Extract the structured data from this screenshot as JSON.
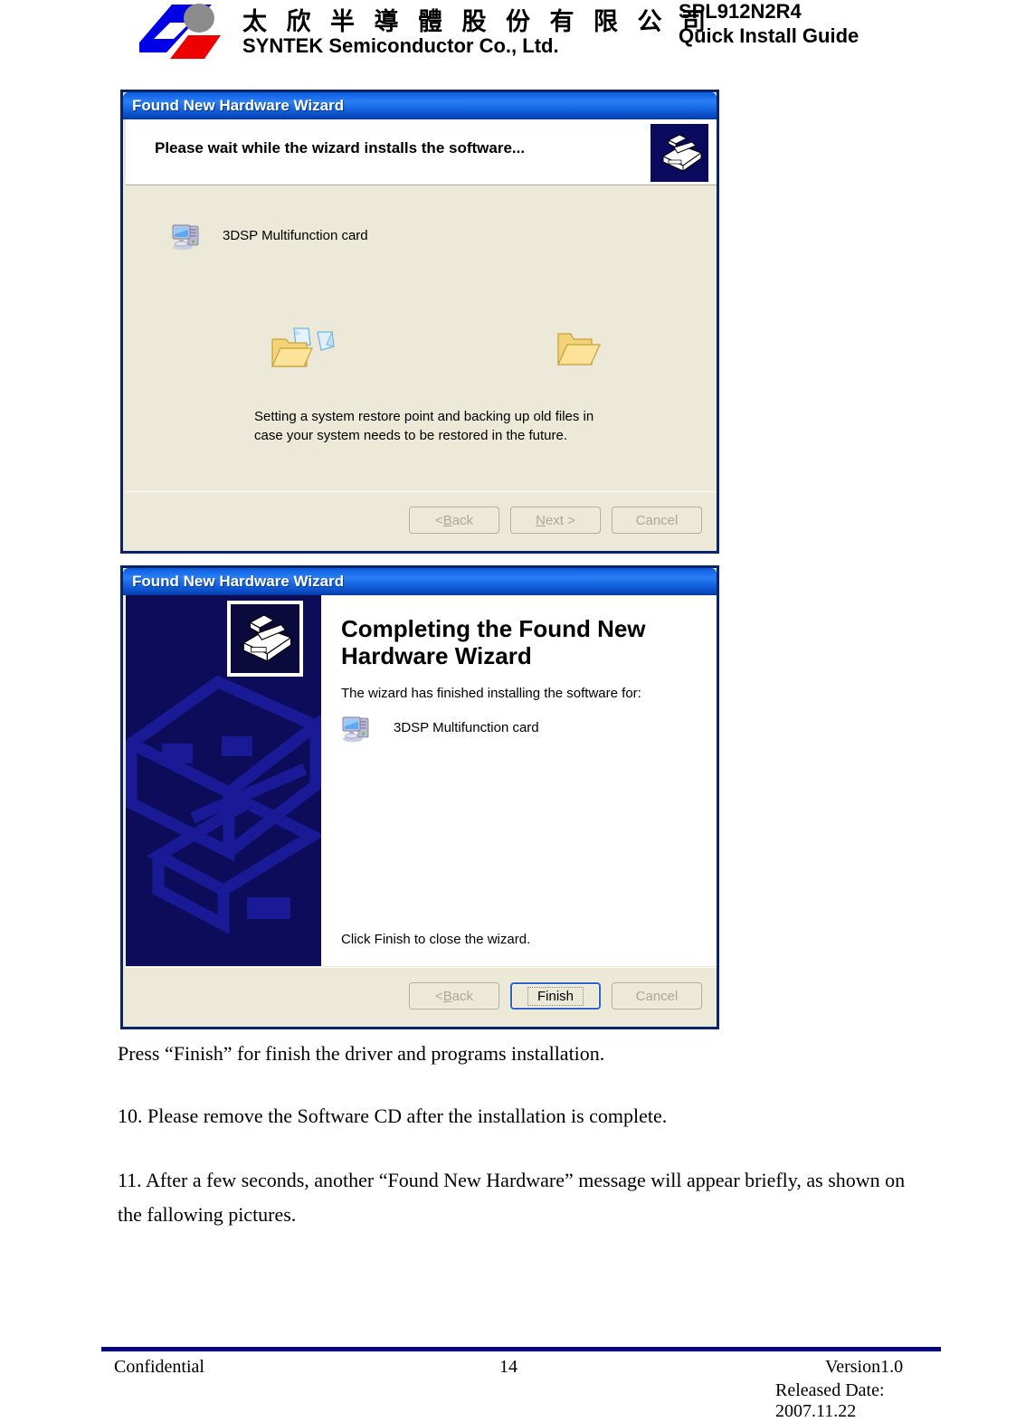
{
  "header": {
    "logo_icon": "syntek-logo",
    "company_cn": "太 欣 半 導 體 股 份 有 限 公 司",
    "company_en": "SYNTEK Semiconductor Co., Ltd.",
    "doc_code": "SPL912N2R4",
    "doc_subtitle": "Quick Install Guide"
  },
  "dialog1": {
    "title": "Found New Hardware Wizard",
    "heading": "Please wait while the wizard installs the software...",
    "header_icon": "hardware-wizard-icon",
    "device_icon": "computer-icon",
    "device_name": "3DSP Multifunction card",
    "anim_source_icon": "open-folder-with-document-icon",
    "anim_dest_icon": "folder-icon",
    "status_line1": "Setting a system restore point and backing up old files in",
    "status_line2": "case your system needs to be restored in the future.",
    "buttons": {
      "back": "< Back",
      "back_prefix": "< ",
      "back_accel": "B",
      "back_rest": "ack",
      "next_accel": "N",
      "next_rest": "ext >",
      "cancel": "Cancel"
    }
  },
  "dialog2": {
    "title": "Found New Hardware Wizard",
    "banner_watermark_icon": "hardware-wizard-watermark",
    "banner_icon": "hardware-wizard-icon",
    "heading_line1": "Completing the Found New",
    "heading_line2": "Hardware Wizard",
    "paragraph": "The wizard has finished installing the software for:",
    "device_icon": "computer-icon",
    "device_name": "3DSP Multifunction card",
    "closing_line": "Click Finish to close the wizard.",
    "buttons": {
      "back_prefix": "< ",
      "back_accel": "B",
      "back_rest": "ack",
      "finish": "Finish",
      "cancel": "Cancel"
    }
  },
  "body": {
    "line1": "Press “Finish” for finish the driver and programs installation.",
    "line2": "10. Please remove the Software CD after the installation is complete.",
    "line3": "11. After a few seconds, another “Found New Hardware” message will appear briefly, as shown on the fallowing pictures."
  },
  "footer": {
    "left": "Confidential",
    "page_number": "14",
    "version": "Version1.0",
    "released": "Released Date: 2007.11.22",
    "rule_color": "#000080"
  },
  "colors": {
    "titlebar_blue": "#1464e0",
    "dialog_border": "#0a246a",
    "dialog_face": "#ece9d8",
    "banner_navy": "#0c0c5a",
    "logo_blue": "#0000e6",
    "logo_red": "#ee0000",
    "logo_gray": "#8c8c8c"
  }
}
